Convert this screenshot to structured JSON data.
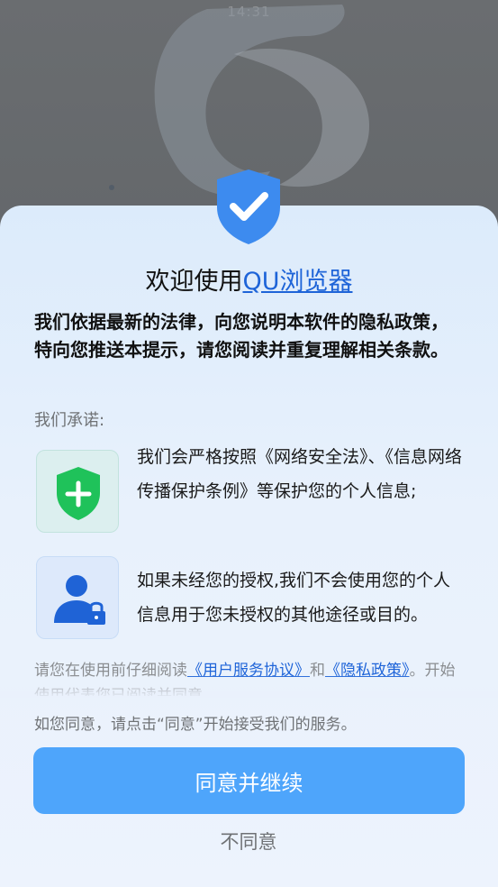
{
  "background": {
    "status_time": "14:31"
  },
  "dialog": {
    "badge_icon": "shield-check-icon",
    "title_prefix": "欢迎使用",
    "title_app_name": "QU浏览器",
    "lead": "我们依据最新的法律，向您说明本软件的隐私政策，特向您推送本提示，请您阅读并重复理解相关条款。",
    "promise_label": "我们承诺:",
    "items": [
      {
        "icon": "shield-plus-icon",
        "text": "我们会严格按照《网络安全法》、《信息网络传播保护条例》等保护您的个人信息;"
      },
      {
        "icon": "user-lock-icon",
        "text": "如果未经您的授权,我们不会使用您的个人信息用于您未授权的其他途径或目的。"
      }
    ],
    "agreement": {
      "prefix": "请您在使用前仔细阅读",
      "user_agreement_link": "《用户服务协议》",
      "conjunction": "和",
      "privacy_policy_link": "《隐私政策》",
      "suffix": "。开始使用代表您已阅读并同意"
    },
    "consent_hint": "如您同意，请点击“同意”开始接受我们的服务。",
    "agree_button": "同意并继续",
    "disagree_button": "不同意"
  },
  "colors": {
    "primary_button": "#4ea5fb",
    "link": "#1e64d8",
    "badge_blue": "#3d8bef",
    "shield_green": "#1fc25a",
    "user_blue": "#1f63d6"
  }
}
